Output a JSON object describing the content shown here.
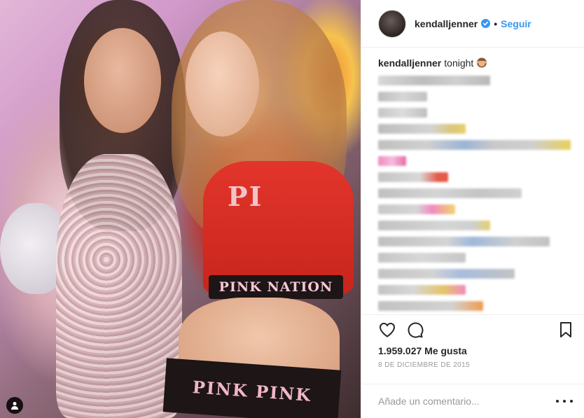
{
  "post": {
    "username": "kendalljenner",
    "separator": "•",
    "follow_label": "Seguir",
    "caption_user": "kendalljenner",
    "caption_text": "tonight",
    "caption_emoji": "see-no-evil-monkey-emoji",
    "likes": "1.959.027 Me gusta",
    "date": "8 de diciembre de 2015",
    "comment_placeholder": "Añade un comentario...",
    "photo_text_top": "PI",
    "photo_text_band": "PINK NATION",
    "photo_text_bottom": "PINK PINK"
  },
  "colors": {
    "accent": "#3897f0",
    "text": "#262626",
    "muted": "#999999",
    "divider": "#efefef"
  },
  "icons": [
    "verified-badge-icon",
    "heart-icon",
    "comment-icon",
    "bookmark-icon",
    "more-options-icon",
    "tagged-user-icon"
  ]
}
